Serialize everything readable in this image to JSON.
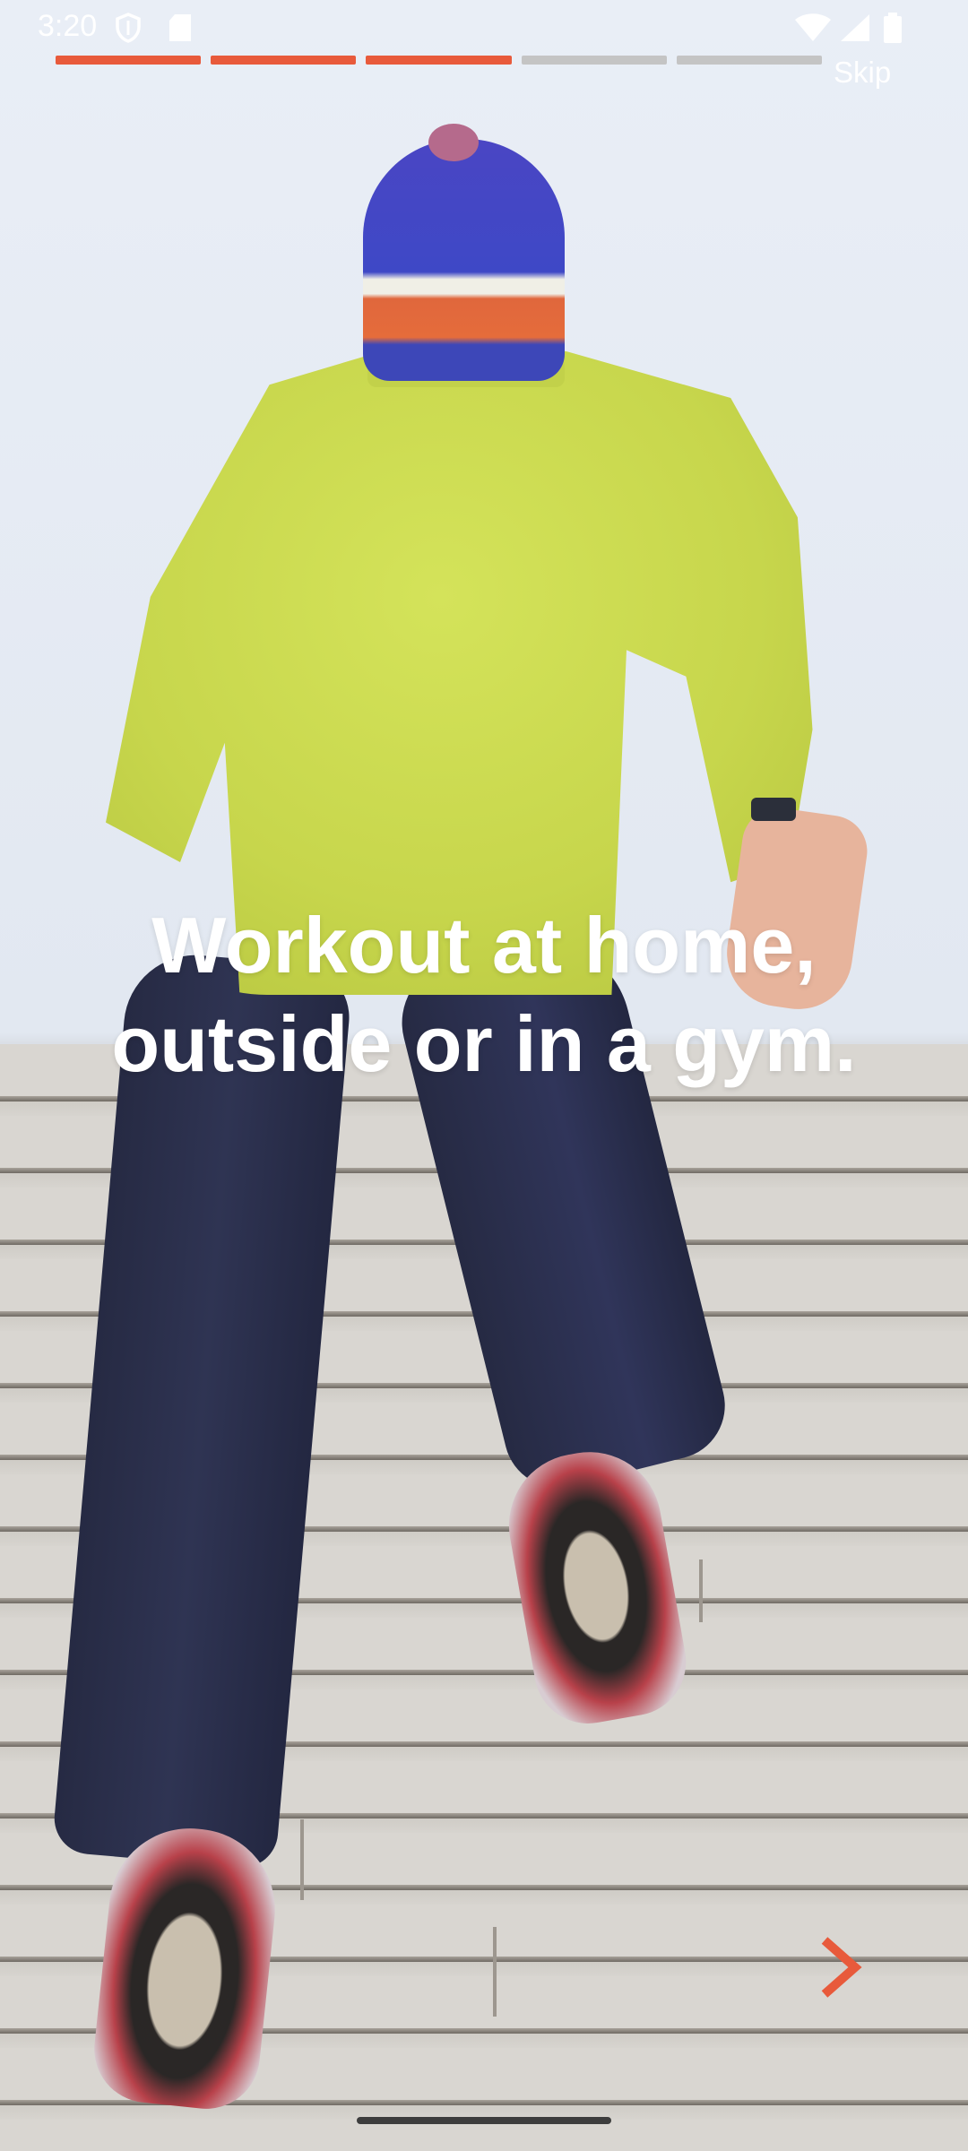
{
  "status_bar": {
    "time": "3:20",
    "icons": [
      "shield-icon",
      "sdcard-icon",
      "wifi-icon",
      "signal-icon",
      "battery-icon"
    ]
  },
  "onboarding": {
    "total_steps": 5,
    "completed_steps": 3,
    "skip_label": "Skip",
    "headline": "Workout at home,\noutside or in a gym.",
    "next_icon": "chevron-right-icon"
  },
  "colors": {
    "accent": "#E85A3B",
    "progress_inactive": "#C4C4C4",
    "text_on_image": "#FFFFFF"
  }
}
